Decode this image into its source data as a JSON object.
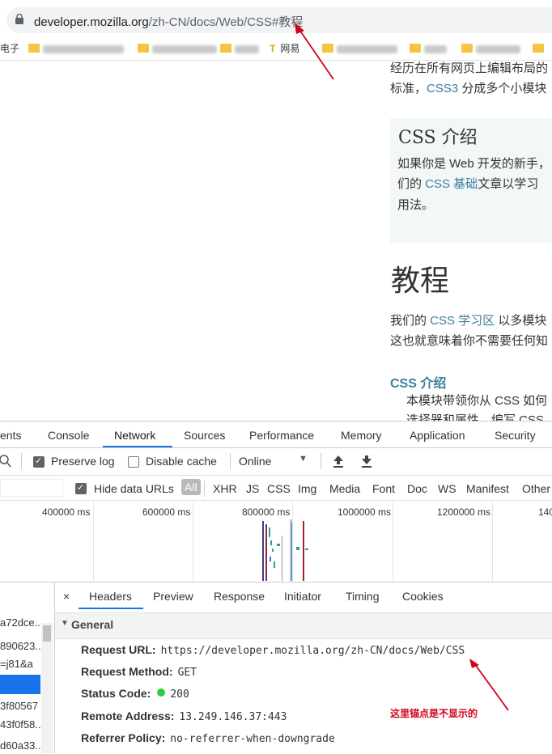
{
  "address_bar": {
    "url_domain": "developer.mozilla.org",
    "url_path": "/zh-CN/docs/Web/CSS#教程"
  },
  "bookmarks": {
    "first_label": "电子",
    "netease_label": "网易"
  },
  "page": {
    "para1_line1": "经历在所有网页上编辑布局的",
    "para1_line2_prefix": "标准，",
    "para1_line2_link": "CSS3",
    "para1_line2_suffix": " 分成多个小模块",
    "note_title": "CSS 介绍",
    "note_line1": "如果你是 Web 开发的新手，",
    "note_line2_prefix": "们的 ",
    "note_line2_link": "CSS 基础",
    "note_line2_suffix": "文章以学习",
    "note_line3": "用法。",
    "tutorial_heading": "教程",
    "tut_line1_prefix": "我们的 ",
    "tut_line1_link": "CSS 学习区",
    "tut_line1_suffix": " 以多模块",
    "tut_line2": "这也就意味着你不需要任何知",
    "sub_heading": "CSS 介绍",
    "sub_line1": "本模块带领你从 CSS 如何",
    "sub_line2": "选择器和属性，编写 CSS"
  },
  "devtools": {
    "tabs": [
      "ents",
      "Console",
      "Network",
      "Sources",
      "Performance",
      "Memory",
      "Application",
      "Security"
    ],
    "active_tab": "Network",
    "toolbar": {
      "preserve_log": "Preserve log",
      "disable_cache": "Disable cache",
      "throttle": "Online"
    },
    "filter": {
      "hide_data_urls": "Hide data URLs",
      "types": [
        "All",
        "XHR",
        "JS",
        "CSS",
        "Img",
        "Media",
        "Font",
        "Doc",
        "WS",
        "Manifest",
        "Other"
      ]
    },
    "timeline_labels": [
      "400000 ms",
      "600000 ms",
      "800000 ms",
      "1000000 ms",
      "1200000 ms",
      "140"
    ],
    "requests": [
      "a72dce..",
      "890623..",
      "=j81&a",
      "",
      "3f80567",
      "43f0f58..",
      "d60a33.."
    ],
    "detail_tabs": [
      "×",
      "Headers",
      "Preview",
      "Response",
      "Initiator",
      "Timing",
      "Cookies"
    ],
    "general_label": "General",
    "headers": [
      {
        "key": "Request URL:",
        "value": "https://developer.mozilla.org/zh-CN/docs/Web/CSS"
      },
      {
        "key": "Request Method:",
        "value": "GET"
      },
      {
        "key": "Status Code:",
        "value": "200"
      },
      {
        "key": "Remote Address:",
        "value": "13.249.146.37:443"
      },
      {
        "key": "Referrer Policy:",
        "value": "no-referrer-when-downgrade"
      }
    ],
    "annotation": "这里锚点是不显示的"
  },
  "colors": {
    "link": "#3d7e9a",
    "active_tab": "#1a73e8",
    "status_ok": "#2ecc40",
    "annotation": "#d0021b"
  }
}
